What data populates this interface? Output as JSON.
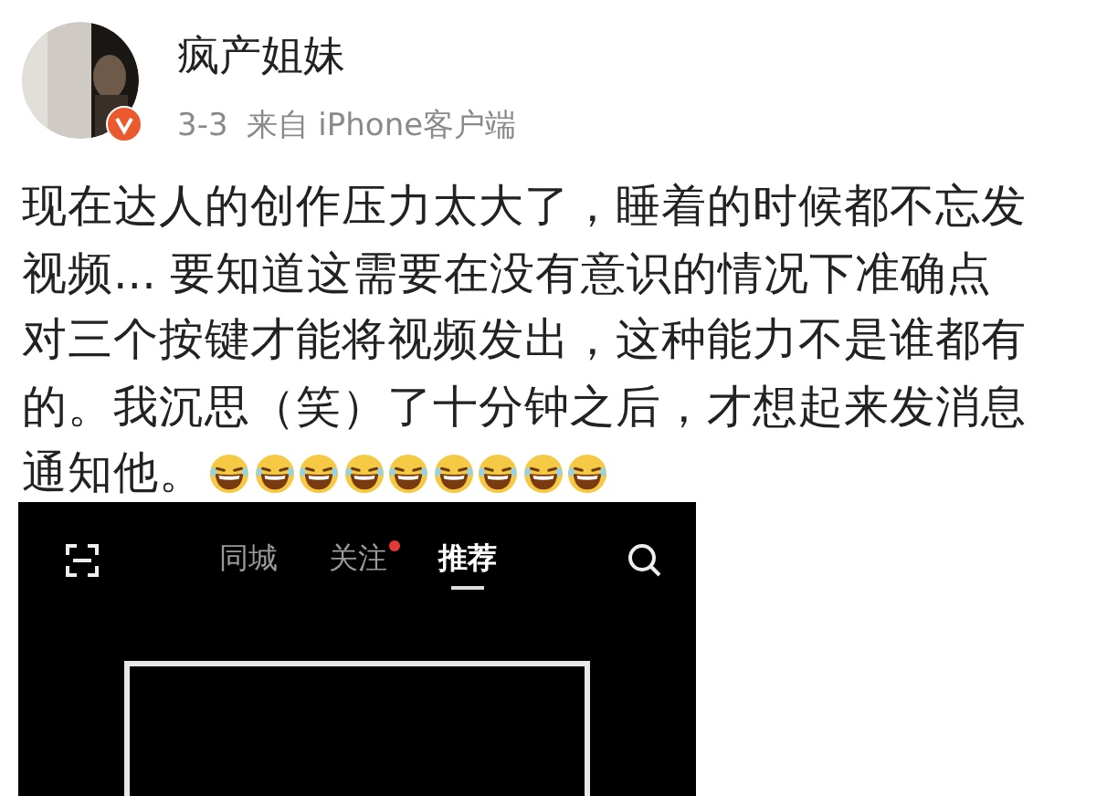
{
  "post": {
    "author": "疯产姐妹",
    "date": "3-3",
    "source": "来自 iPhone客户端",
    "lines": [
      "现在达人的创作压力太大了，睡着的时候都不忘发",
      "视频... 要知道这需要在没有意识的情况下准确点",
      "对三个按键才能将视频发出，这种能力不是谁都有",
      "的。我沉思（笑）了十分钟之后，才想起来发消息"
    ],
    "last_line": "通知他。",
    "emojis": [
      {
        "kind": "laugh"
      },
      {
        "kind": "laugh"
      },
      {
        "kind": "laugh"
      },
      {
        "kind": "laugh"
      },
      {
        "kind": "laugh"
      },
      {
        "kind": "laugh"
      },
      {
        "kind": "laugh"
      },
      {
        "kind": "laugh"
      },
      {
        "kind": "laugh"
      }
    ]
  },
  "screenshot": {
    "tabs": [
      {
        "label": "同城",
        "selected": false,
        "dot": false
      },
      {
        "label": "关注",
        "selected": false,
        "dot": true
      },
      {
        "label": "推荐",
        "selected": true,
        "dot": false
      }
    ]
  }
}
